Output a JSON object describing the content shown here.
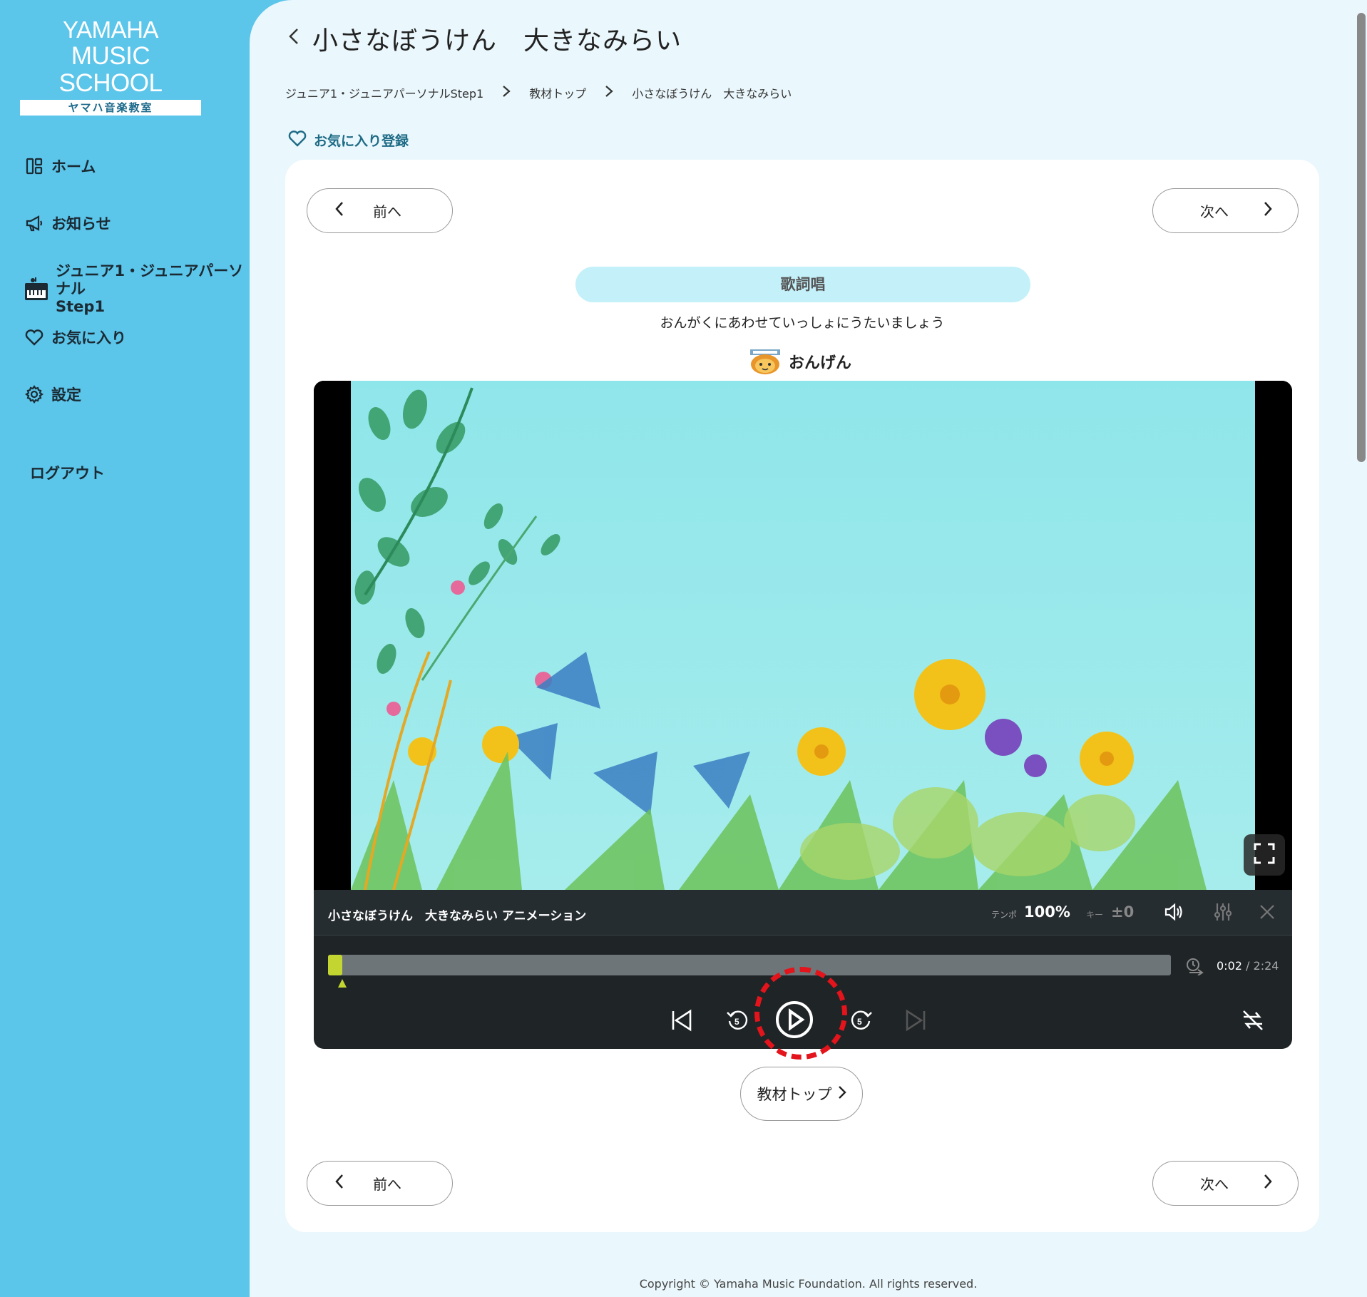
{
  "sidebar": {
    "logo_line1": "YAMAHA",
    "logo_line2": "MUSIC SCHOOL",
    "logo_line3": "ヤマハ音楽教室",
    "items": [
      {
        "label": "ホーム",
        "icon": "grid-icon"
      },
      {
        "label": "お知らせ",
        "icon": "megaphone-icon"
      },
      {
        "label": "ジュニア1・ジュニアパーソナル",
        "label_line2": "Step1",
        "icon": "keyboard-icon"
      },
      {
        "label": "お気に入り",
        "icon": "heart-icon"
      },
      {
        "label": "設定",
        "icon": "gear-icon"
      },
      {
        "label": "ログアウト"
      }
    ]
  },
  "header": {
    "title": "小さなぼうけん　大きなみらい",
    "breadcrumb": [
      "ジュニア1・ジュニアパーソナルStep1",
      "教材トップ",
      "小さなぼうけん　大きなみらい"
    ],
    "favorite_label": "お気に入り登録"
  },
  "nav": {
    "prev_label": "前へ",
    "next_label": "次へ"
  },
  "content": {
    "section_label": "歌詞唱",
    "instruction": "おんがくにあわせていっしょにうたいましょう",
    "audio_source_label": "おんげん"
  },
  "player": {
    "video_title": "小さなぼうけん　大きなみらい アニメーション",
    "tempo_label": "テンポ",
    "tempo_value": "100%",
    "key_label": "キー",
    "key_value": "±0",
    "current_time": "0:02",
    "duration": "2:24",
    "progress": 0.014,
    "colors": {
      "progress": "#c2d531",
      "bar_bg": "#1f2427"
    }
  },
  "footer": {
    "kyozai_top_label": "教材トップ",
    "copyright": "Copyright © Yamaha Music Foundation. All rights reserved."
  },
  "colors": {
    "sidebar": "#5bc5ea",
    "main_bg": "#eaf7fc",
    "pill": "#c4f0fa",
    "accent": "#1e6b86",
    "highlight": "#e3141b"
  }
}
